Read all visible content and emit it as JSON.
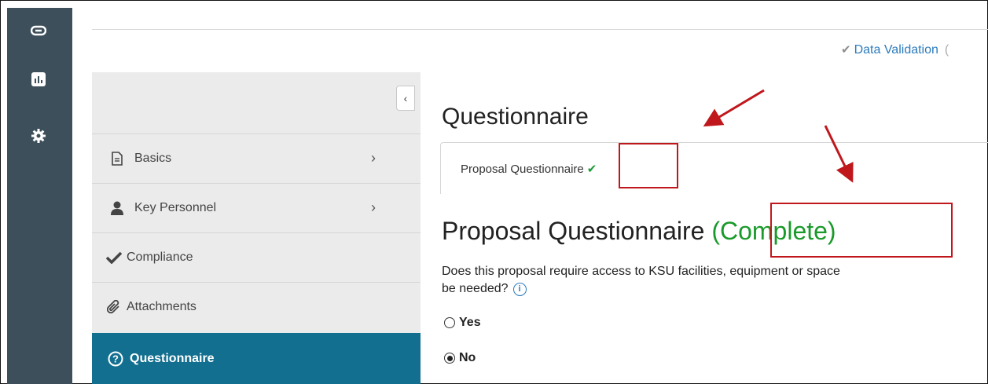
{
  "rail": {
    "icons": [
      "link-icon",
      "chart-icon",
      "gear-icon"
    ]
  },
  "header": {
    "data_validation_label": "Data Validation",
    "data_validation_paren": "("
  },
  "sidenav": {
    "items": [
      {
        "label": "Basics",
        "icon": "document-icon",
        "has_arrow": true
      },
      {
        "label": "Key Personnel",
        "icon": "person-icon",
        "has_arrow": true
      },
      {
        "label": "Compliance",
        "icon": "check-icon",
        "has_arrow": false
      },
      {
        "label": "Attachments",
        "icon": "paperclip-icon",
        "has_arrow": false
      },
      {
        "label": "Questionnaire",
        "icon": "question-circle-icon",
        "has_arrow": false,
        "active": true
      }
    ],
    "collapse_glyph": "‹"
  },
  "main": {
    "title": "Questionnaire",
    "tab_label": "Proposal Questionnaire",
    "section_title": "Proposal Questionnaire",
    "section_status": "(Complete)",
    "question_text": "Does this proposal require access to KSU facilities, equipment or space",
    "question_text_line2": "be needed?",
    "options": [
      {
        "label": "Yes",
        "selected": false
      },
      {
        "label": "No",
        "selected": true
      }
    ]
  },
  "colors": {
    "rail": "#3d4f5b",
    "active_nav": "#136f8f",
    "complete_green": "#1a9a2a",
    "annotation_red": "#c0171c",
    "link_blue": "#2b7bbd"
  }
}
